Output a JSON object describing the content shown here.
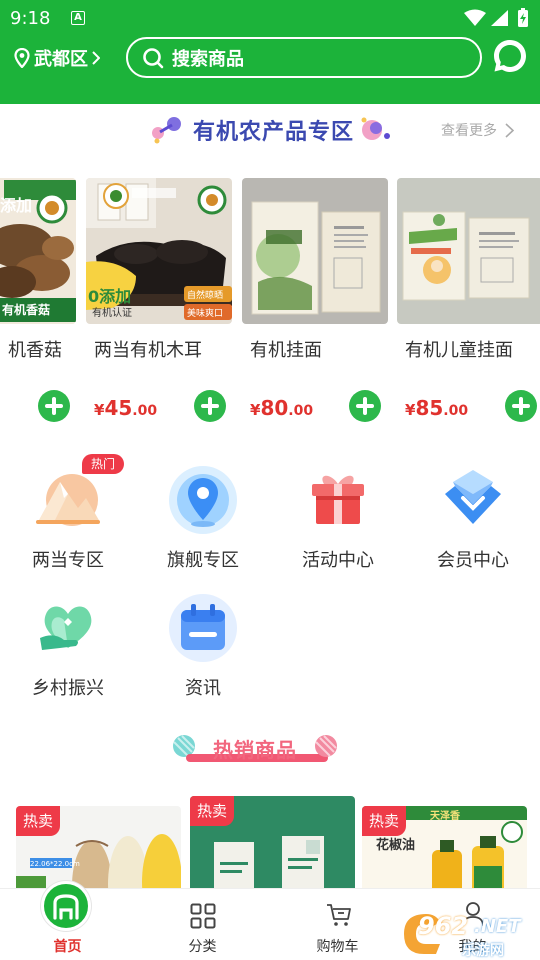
{
  "status": {
    "time": "9:18",
    "app_indicator": "A"
  },
  "header": {
    "location": "武都区",
    "search_placeholder": "搜索商品",
    "chat_icon": "chat-bubble-icon"
  },
  "organic": {
    "title": "有机农产品专区",
    "see_more": "查看更多",
    "products": [
      {
        "name": "机香菇",
        "image_text": "有机香菇",
        "image_badge": "添加"
      },
      {
        "name": "两当有机木耳",
        "price_symbol": "¥",
        "price_int": "45",
        "price_dec": ".00",
        "image_text_1": "0添加",
        "image_text_2": "有机认证",
        "image_text_3": "自然晾晒",
        "image_text_4": "美味爽口"
      },
      {
        "name": "有机挂面",
        "price_symbol": "¥",
        "price_int": "80",
        "price_dec": ".00"
      },
      {
        "name": "有机儿童挂面",
        "price_symbol": "¥",
        "price_int": "85",
        "price_dec": ".00"
      }
    ]
  },
  "grid": {
    "hot_badge": "热门",
    "items": [
      {
        "label": "两当专区",
        "icon": "mountain-icon"
      },
      {
        "label": "旗舰专区",
        "icon": "location-pin-icon"
      },
      {
        "label": "活动中心",
        "icon": "gift-box-icon"
      },
      {
        "label": "会员中心",
        "icon": "diamond-icon"
      },
      {
        "label": "乡村振兴",
        "icon": "heart-hand-icon"
      },
      {
        "label": "资讯",
        "icon": "calendar-icon"
      }
    ]
  },
  "hot": {
    "title": "热销商品",
    "cards": [
      {
        "tag": "热卖",
        "image_text": "22.06*22.0cm"
      },
      {
        "tag": "热卖"
      },
      {
        "tag": "热卖",
        "image_text_1": "天泽香",
        "image_text_2": "花椒油"
      }
    ]
  },
  "tabbar": {
    "tabs": [
      {
        "label": "首页",
        "active": true
      },
      {
        "label": "分类"
      },
      {
        "label": "购物车"
      },
      {
        "label": "我的"
      }
    ]
  },
  "watermark": {
    "text_1": "962",
    "text_2": ".NET",
    "text_3": "乐游网"
  },
  "colors": {
    "brand_green": "#1cb33a",
    "price_red": "#e0322e",
    "title_blue": "#3b49b0",
    "hot_pink": "#f2667e"
  }
}
